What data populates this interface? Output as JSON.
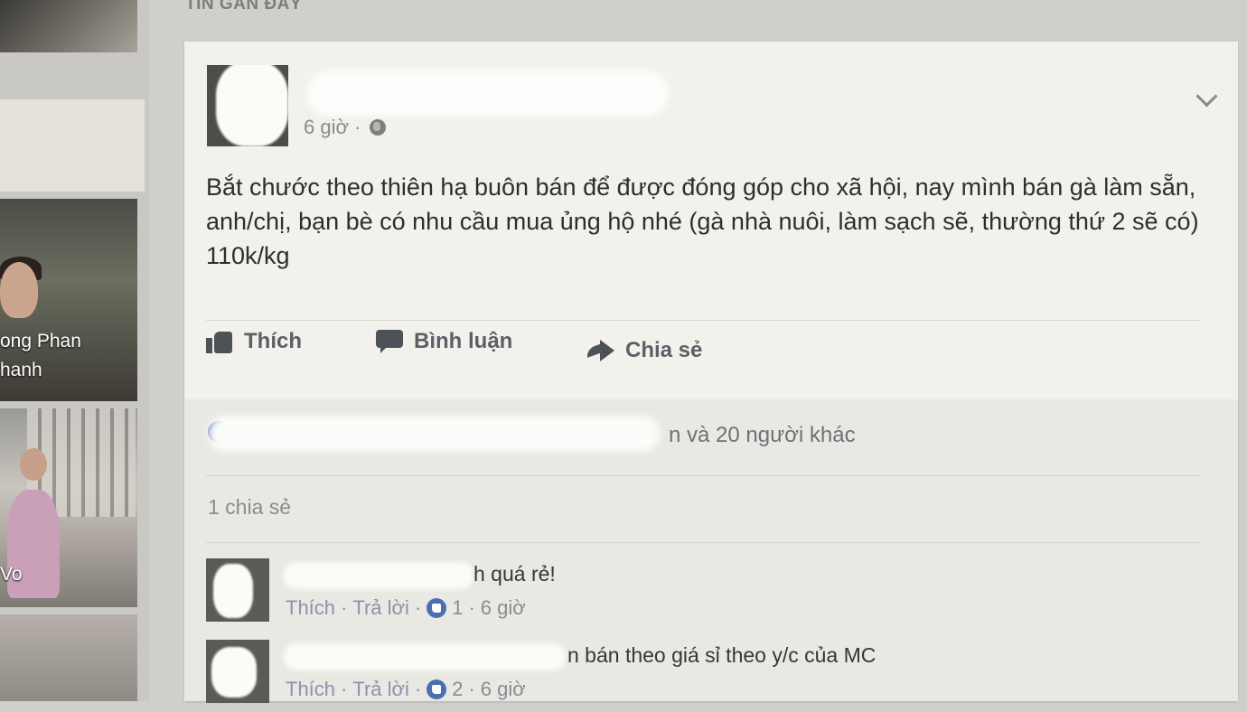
{
  "section": {
    "label": "TIN GẦN ĐÂY"
  },
  "sidebar": {
    "tiles": [
      {
        "name_line1": "ong Phan",
        "name_line2": "hanh"
      },
      {
        "name_line1": "Vo"
      }
    ]
  },
  "post": {
    "time": "6 giờ",
    "separator": "·",
    "body": "Bắt chước theo thiên hạ buôn bán để được đóng góp cho xã hội, nay mình bán gà làm sẵn, anh/chị, bạn bè có nhu cầu mua ủng hộ nhé (gà nhà nuôi, làm sạch sẽ, thường thứ 2 sẽ có) 110k/kg",
    "actions": {
      "like": "Thích",
      "comment": "Bình luận",
      "share": "Chia sẻ"
    },
    "likes_suffix": "n và 20 người khác",
    "shares": "1 chia sẻ"
  },
  "comments": [
    {
      "text": "h quá rẻ!",
      "like_label": "Thích",
      "reply_label": "Trả lời",
      "likes": "1",
      "time": "6 giờ"
    },
    {
      "text": "n bán theo giá sỉ theo y/c của MC",
      "like_label": "Thích",
      "reply_label": "Trả lời",
      "likes": "2",
      "time": "6 giờ"
    }
  ]
}
